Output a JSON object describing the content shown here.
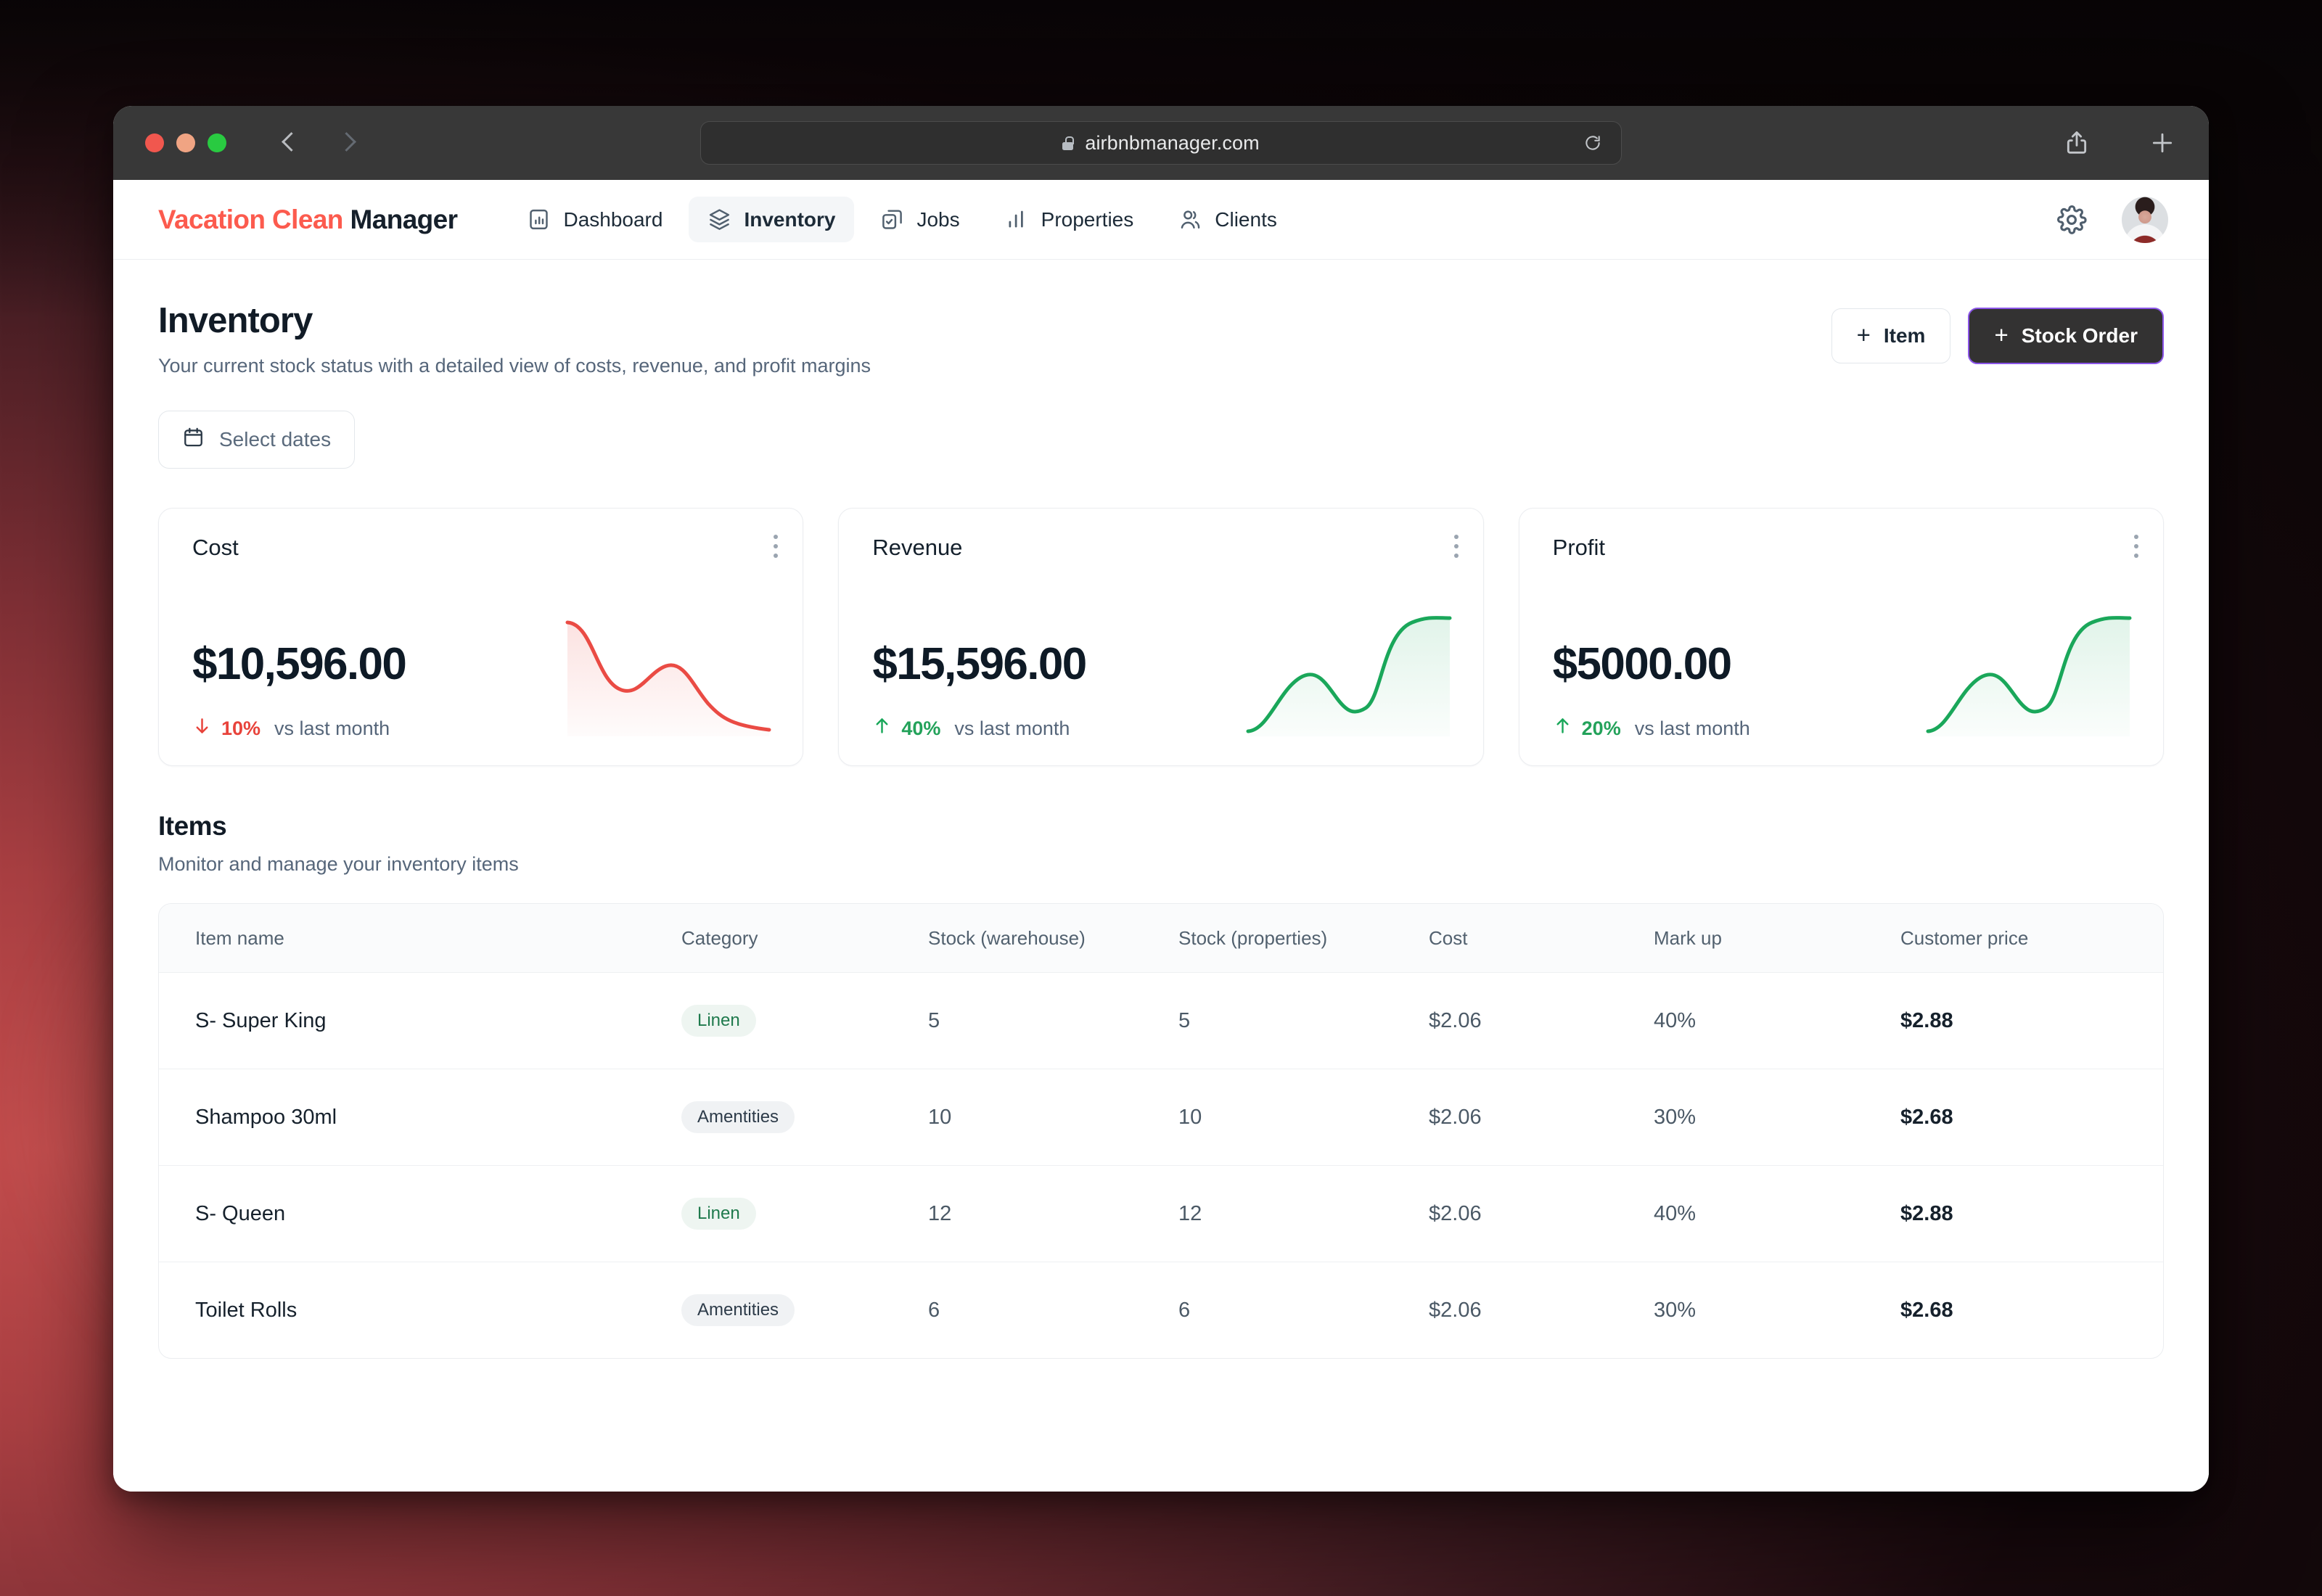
{
  "browser": {
    "url": "airbnbmanager.com",
    "lock_icon": "lock-icon",
    "back_icon": "chevron-left-icon",
    "forward_icon": "chevron-right-icon",
    "reload_icon": "reload-icon",
    "share_icon": "share-icon",
    "new_tab_icon": "plus-icon"
  },
  "header": {
    "logo_accent": "Vacation Clean",
    "logo_dark": "Manager",
    "nav": [
      {
        "label": "Dashboard",
        "icon": "bar-chart-icon",
        "active": false
      },
      {
        "label": "Inventory",
        "icon": "layers-icon",
        "active": true
      },
      {
        "label": "Jobs",
        "icon": "tasks-icon",
        "active": false
      },
      {
        "label": "Properties",
        "icon": "chart-bars-icon",
        "active": false
      },
      {
        "label": "Clients",
        "icon": "users-icon",
        "active": false
      }
    ],
    "settings_icon": "gear-icon",
    "avatar": "user-avatar"
  },
  "page": {
    "title": "Inventory",
    "subtitle": "Your current stock status with a detailed view of costs, revenue, and profit margins",
    "add_item_label": "Item",
    "add_stock_order_label": "Stock Order",
    "date_picker_label": "Select dates",
    "date_picker_icon": "calendar-icon"
  },
  "stats": [
    {
      "title": "Cost",
      "value": "$10,596.00",
      "delta": "10%",
      "direction": "down",
      "note": "vs last month",
      "color": "#e8433b"
    },
    {
      "title": "Revenue",
      "value": "$15,596.00",
      "delta": "40%",
      "direction": "up",
      "note": "vs last month",
      "color": "#1aa75a"
    },
    {
      "title": "Profit",
      "value": "$5000.00",
      "delta": "20%",
      "direction": "up",
      "note": "vs last month",
      "color": "#1aa75a"
    }
  ],
  "chart_data": [
    {
      "type": "line",
      "title": "Cost",
      "series": [
        {
          "name": "Cost",
          "values": [
            86,
            78,
            42,
            22,
            26,
            44,
            50,
            30,
            8
          ]
        }
      ],
      "x": [
        0,
        1,
        2,
        3,
        4,
        5,
        6,
        7,
        8
      ],
      "color": "#ea4b44",
      "fill": true,
      "grid": false,
      "legend": "none"
    },
    {
      "type": "line",
      "title": "Revenue",
      "series": [
        {
          "name": "Revenue",
          "values": [
            4,
            22,
            52,
            62,
            52,
            36,
            34,
            68,
            92
          ]
        }
      ],
      "x": [
        0,
        1,
        2,
        3,
        4,
        5,
        6,
        7,
        8
      ],
      "color": "#1aa75a",
      "fill": true,
      "grid": false,
      "legend": "none"
    },
    {
      "type": "line",
      "title": "Profit",
      "series": [
        {
          "name": "Profit",
          "values": [
            4,
            22,
            52,
            62,
            52,
            36,
            34,
            68,
            92
          ]
        }
      ],
      "x": [
        0,
        1,
        2,
        3,
        4,
        5,
        6,
        7,
        8
      ],
      "color": "#1aa75a",
      "fill": true,
      "grid": false,
      "legend": "none"
    }
  ],
  "items": {
    "title": "Items",
    "subtitle": "Monitor and manage your inventory items",
    "columns": [
      "Item name",
      "Category",
      "Stock (warehouse)",
      "Stock (properties)",
      "Cost",
      "Mark up",
      "Customer price"
    ],
    "rows": [
      {
        "name": "S- Super King",
        "category": "Linen",
        "stock_warehouse": "5",
        "stock_properties": "5",
        "cost": "$2.06",
        "markup": "40%",
        "price": "$2.88"
      },
      {
        "name": "Shampoo 30ml",
        "category": "Amentities",
        "stock_warehouse": "10",
        "stock_properties": "10",
        "cost": "$2.06",
        "markup": "30%",
        "price": "$2.68"
      },
      {
        "name": "S- Queen",
        "category": "Linen",
        "stock_warehouse": "12",
        "stock_properties": "12",
        "cost": "$2.06",
        "markup": "40%",
        "price": "$2.88"
      },
      {
        "name": "Toilet Rolls",
        "category": "Amentities",
        "stock_warehouse": "6",
        "stock_properties": "6",
        "cost": "$2.06",
        "markup": "30%",
        "price": "$2.68"
      }
    ]
  }
}
